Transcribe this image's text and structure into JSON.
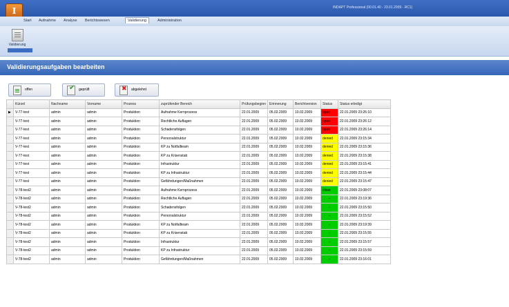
{
  "app": {
    "logo_letter": "I",
    "title": "INDAPT Professional (00.01.40 - 23.01.2009 - RC1)"
  },
  "menu": {
    "tabs": [
      "Start",
      "Aufnahme",
      "Analyse",
      "Berichtswesen",
      "Validierung",
      "Administration"
    ],
    "active": "Validierung"
  },
  "ribbon": {
    "button_label": "Validierung"
  },
  "page": {
    "title": "Validierungsaufgaben bearbeiten"
  },
  "actions": {
    "open": "offen",
    "checked": "geprüft",
    "rejected": "abgelehnt"
  },
  "colors": {
    "red": "#ff0000",
    "yellow": "#ffff00",
    "green": "#00cc00"
  },
  "table": {
    "columns": [
      "Kürzel",
      "Nachname",
      "Vorname",
      "Prozess",
      "zuprüfender Bereich",
      "Prüfungsbeginn",
      "Erinnerung",
      "Berichtversion",
      "Status",
      "Status erledigt"
    ],
    "rows": [
      [
        "V-77-test",
        "admin",
        "admin",
        "Produktion",
        "Aufnahme Kernprozess",
        "22.01.2009",
        "05.02.2009",
        "10.02.2009",
        "open",
        "red",
        "22.01.2009 23:26:10"
      ],
      [
        "V-77-test",
        "admin",
        "admin",
        "Produktion",
        "Rechtliche Auflagen",
        "22.01.2009",
        "05.02.2009",
        "10.02.2009",
        "open",
        "red",
        "22.01.2009 23:26:12"
      ],
      [
        "V-77-test",
        "admin",
        "admin",
        "Produktion",
        "Schadensfolgen",
        "22.01.2009",
        "05.02.2009",
        "10.02.2009",
        "open",
        "red",
        "22.01.2009 23:26:14"
      ],
      [
        "V-77-test",
        "admin",
        "admin",
        "Produktion",
        "Personalstruktur",
        "22.01.2009",
        "05.02.2009",
        "10.02.2009",
        "denied",
        "yellow",
        "22.01.2009 23:15:34"
      ],
      [
        "V-77-test",
        "admin",
        "admin",
        "Produktion",
        "KP zu Notfallteam",
        "22.01.2009",
        "05.02.2009",
        "10.02.2009",
        "denied",
        "yellow",
        "22.01.2009 23:15:36"
      ],
      [
        "V-77-test",
        "admin",
        "admin",
        "Produktion",
        "KP zu Krisenstab",
        "22.01.2009",
        "05.02.2009",
        "10.02.2009",
        "denied",
        "yellow",
        "22.01.2009 23:15:38"
      ],
      [
        "V-77-test",
        "admin",
        "admin",
        "Produktion",
        "Infrastruktur",
        "22.01.2009",
        "05.02.2009",
        "10.02.2009",
        "denied",
        "yellow",
        "22.01.2009 23:15:41"
      ],
      [
        "V-77-test",
        "admin",
        "admin",
        "Produktion",
        "KP zu Infrastruktur",
        "22.01.2009",
        "05.02.2009",
        "10.02.2009",
        "denied",
        "yellow",
        "22.01.2009 23:15:44"
      ],
      [
        "V-77-test",
        "admin",
        "admin",
        "Produktion",
        "Gefährdungen/Maßnahmen",
        "22.01.2009",
        "05.02.2009",
        "10.02.2009",
        "denied",
        "yellow",
        "22.01.2009 23:15:47"
      ],
      [
        "V-78-test2",
        "admin",
        "admin",
        "Produktion",
        "Aufnahme Kernprozess",
        "22.01.2009",
        "05.02.2009",
        "10.02.2009",
        "close",
        "green",
        "22.01.2009 23:08:07"
      ],
      [
        "V-78-test2",
        "admin",
        "admin",
        "Produktion",
        "Rechtliche Auflagen",
        "22.01.2009",
        "05.02.2009",
        "10.02.2009",
        "-",
        "green",
        "22.01.2009 23:19:36"
      ],
      [
        "V-78-test2",
        "admin",
        "admin",
        "Produktion",
        "Schadensfolgen",
        "22.01.2009",
        "05.02.2009",
        "10.02.2009",
        "-",
        "green",
        "22.01.2009 23:15:50"
      ],
      [
        "V-78-test2",
        "admin",
        "admin",
        "Produktion",
        "Personalstruktur",
        "22.01.2009",
        "05.02.2009",
        "10.02.2009",
        "-",
        "green",
        "22.01.2009 23:15:52"
      ],
      [
        "V-78-test2",
        "admin",
        "admin",
        "Produktion",
        "KP zu Notfallteam",
        "22.01.2009",
        "05.02.2009",
        "10.02.2009",
        "-",
        "green",
        "22.01.2009 23:19:39"
      ],
      [
        "V-78-test2",
        "admin",
        "admin",
        "Produktion",
        "KP zu Krisenstab",
        "22.01.2009",
        "05.02.2009",
        "10.02.2009",
        "-",
        "green",
        "22.01.2009 23:15:55"
      ],
      [
        "V-78-test2",
        "admin",
        "admin",
        "Produktion",
        "Infrastruktur",
        "22.01.2009",
        "05.02.2009",
        "10.02.2009",
        "-",
        "green",
        "22.01.2009 23:15:57"
      ],
      [
        "V-78-test2",
        "admin",
        "admin",
        "Produktion",
        "KP zu Infrastruktur",
        "22.01.2009",
        "05.02.2009",
        "10.02.2009",
        "-",
        "green",
        "22.01.2009 23:15:59"
      ],
      [
        "V-78-test2",
        "admin",
        "admin",
        "Produktion",
        "Gefährdungen/Maßnahmen",
        "22.01.2009",
        "05.02.2009",
        "10.02.2009",
        "-",
        "green",
        "22.01.2009 23:16:01"
      ]
    ]
  }
}
